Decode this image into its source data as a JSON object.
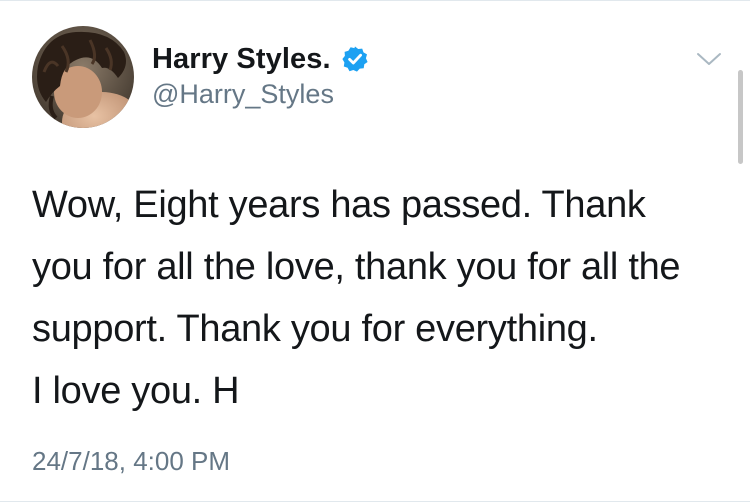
{
  "tweet": {
    "author": {
      "display_name": "Harry Styles.",
      "handle": "@Harry_Styles",
      "verified": true,
      "avatar_icon": "profile-photo"
    },
    "text_lines": [
      "Wow, Eight years has passed. Thank",
      "you for all the love, thank you for all the",
      "support. Thank you for everything.",
      "I love you. H"
    ],
    "timestamp": "24/7/18, 4:00 PM",
    "menu_icon": "chevron-down-icon"
  },
  "colors": {
    "text_primary": "#14171a",
    "text_secondary": "#657786",
    "verified_badge": "#1da1f2",
    "divider": "#e1e8ed"
  }
}
